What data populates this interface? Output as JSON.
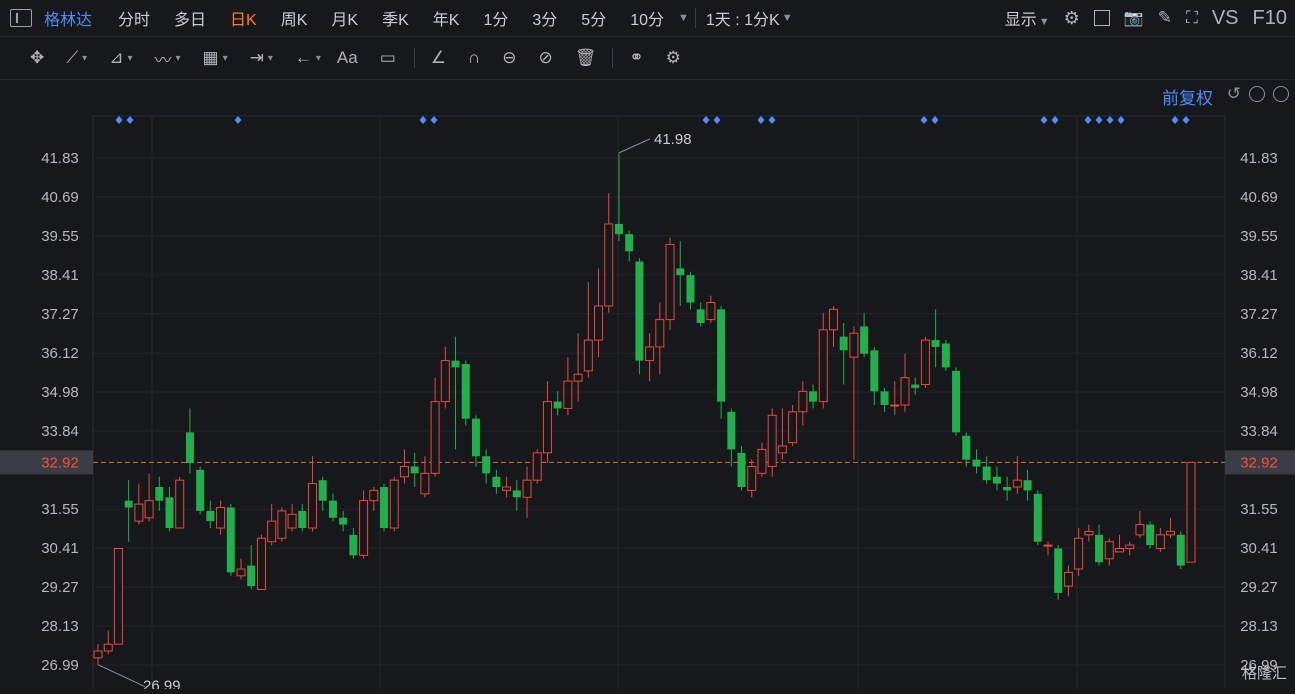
{
  "header": {
    "stock_name": "格林达",
    "tabs": [
      "分时",
      "多日",
      "日K",
      "周K",
      "月K",
      "季K",
      "年K",
      "1分",
      "3分",
      "5分",
      "10分"
    ],
    "active_tab": "日K",
    "period_dropdown": "1天 : 1分K",
    "display_label": "显示",
    "vs_label": "VS",
    "f10_label": "F10"
  },
  "drawing_toolbar": {
    "icons": [
      "move-icon",
      "line-icon",
      "polyline-icon",
      "wave-icon",
      "fib-icon",
      "range-icon",
      "arrow-icon",
      "text-icon",
      "comment-icon",
      "ruler-icon",
      "magnet-icon",
      "eye-link-icon",
      "eye-off-icon",
      "trash-icon",
      "link-icon",
      "settings-icon"
    ],
    "text_tool_label": "Aa"
  },
  "chart": {
    "adjust_label": "前复权",
    "current_price": "32.92",
    "high_label": "41.98",
    "low_label": "26.99",
    "price_ticks": [
      "41.83",
      "40.69",
      "39.55",
      "38.41",
      "37.27",
      "36.12",
      "34.98",
      "33.84",
      "32.92",
      "31.55",
      "30.41",
      "29.27",
      "28.13",
      "26.99"
    ],
    "right_bottom_tick": "26.99",
    "watermark": "格隆汇"
  },
  "chart_data": {
    "type": "candlestick",
    "ylim": [
      26.7,
      42.3
    ],
    "current_price": 32.92,
    "high": 41.98,
    "low": 26.99,
    "candles": [
      [
        27.2,
        27.4,
        27.0,
        27.6
      ],
      [
        27.4,
        27.6,
        27.3,
        28.0
      ],
      [
        27.6,
        30.4,
        27.6,
        30.4
      ],
      [
        31.8,
        31.6,
        30.6,
        32.4
      ],
      [
        31.2,
        31.7,
        31.1,
        32.3
      ],
      [
        31.3,
        31.8,
        31.2,
        32.6
      ],
      [
        32.2,
        31.8,
        31.5,
        32.5
      ],
      [
        31.9,
        31.0,
        30.9,
        32.2
      ],
      [
        31.0,
        32.4,
        31.0,
        32.5
      ],
      [
        33.8,
        32.9,
        32.6,
        34.5
      ],
      [
        32.7,
        31.5,
        31.4,
        32.8
      ],
      [
        31.5,
        31.2,
        31.0,
        31.8
      ],
      [
        31.0,
        31.6,
        30.8,
        31.8
      ],
      [
        31.6,
        29.7,
        29.6,
        31.7
      ],
      [
        29.6,
        29.8,
        29.5,
        30.1
      ],
      [
        29.9,
        29.3,
        29.2,
        30.5
      ],
      [
        29.2,
        30.7,
        29.2,
        30.8
      ],
      [
        30.6,
        31.2,
        30.5,
        31.7
      ],
      [
        30.7,
        31.5,
        30.6,
        31.6
      ],
      [
        31.0,
        31.4,
        30.9,
        31.7
      ],
      [
        31.5,
        31.0,
        30.9,
        31.7
      ],
      [
        31.0,
        32.3,
        30.9,
        33.1
      ],
      [
        32.4,
        31.8,
        31.5,
        32.5
      ],
      [
        31.8,
        31.3,
        31.2,
        32.0
      ],
      [
        31.3,
        31.1,
        30.9,
        31.5
      ],
      [
        30.8,
        30.2,
        30.1,
        31.0
      ],
      [
        30.2,
        31.8,
        30.1,
        32.1
      ],
      [
        31.8,
        32.1,
        31.5,
        32.2
      ],
      [
        32.2,
        31.0,
        30.9,
        32.3
      ],
      [
        31.0,
        32.4,
        30.9,
        32.5
      ],
      [
        32.5,
        32.8,
        32.3,
        33.3
      ],
      [
        32.8,
        32.6,
        32.2,
        33.2
      ],
      [
        32.0,
        32.6,
        31.9,
        33.1
      ],
      [
        32.6,
        34.7,
        32.5,
        35.4
      ],
      [
        34.7,
        35.9,
        34.5,
        36.3
      ],
      [
        35.9,
        35.7,
        33.3,
        36.6
      ],
      [
        35.8,
        34.2,
        34.0,
        35.9
      ],
      [
        34.2,
        33.1,
        32.8,
        34.3
      ],
      [
        33.1,
        32.6,
        32.3,
        33.3
      ],
      [
        32.5,
        32.2,
        32.0,
        32.7
      ],
      [
        32.1,
        32.2,
        31.9,
        32.5
      ],
      [
        32.1,
        31.9,
        31.5,
        32.4
      ],
      [
        31.9,
        32.4,
        31.3,
        32.8
      ],
      [
        32.4,
        33.2,
        32.3,
        33.3
      ],
      [
        33.2,
        34.7,
        32.9,
        35.3
      ],
      [
        34.7,
        34.5,
        34.3,
        35.0
      ],
      [
        34.5,
        35.3,
        34.3,
        36.0
      ],
      [
        35.3,
        35.5,
        34.7,
        36.7
      ],
      [
        35.6,
        36.5,
        35.4,
        38.2
      ],
      [
        36.5,
        37.5,
        36.0,
        38.6
      ],
      [
        37.5,
        39.9,
        37.3,
        40.8
      ],
      [
        39.9,
        39.6,
        39.4,
        41.98
      ],
      [
        39.6,
        39.1,
        38.8,
        39.7
      ],
      [
        38.8,
        35.9,
        35.5,
        38.9
      ],
      [
        35.9,
        36.3,
        35.3,
        36.7
      ],
      [
        36.3,
        37.1,
        35.5,
        37.6
      ],
      [
        37.1,
        39.3,
        36.8,
        39.5
      ],
      [
        38.6,
        38.4,
        37.5,
        39.4
      ],
      [
        38.4,
        37.6,
        37.4,
        38.5
      ],
      [
        37.4,
        37.0,
        36.9,
        37.6
      ],
      [
        37.1,
        37.6,
        37.0,
        37.8
      ],
      [
        37.4,
        34.7,
        34.2,
        37.5
      ],
      [
        34.4,
        33.3,
        32.8,
        34.5
      ],
      [
        33.2,
        32.2,
        32.1,
        33.4
      ],
      [
        32.1,
        32.8,
        31.9,
        33.0
      ],
      [
        32.6,
        33.3,
        32.5,
        33.5
      ],
      [
        32.8,
        34.3,
        32.5,
        34.5
      ],
      [
        33.2,
        33.4,
        33.0,
        34.5
      ],
      [
        33.5,
        34.4,
        33.4,
        34.6
      ],
      [
        34.4,
        35.0,
        34.0,
        35.3
      ],
      [
        35.0,
        34.7,
        34.5,
        35.2
      ],
      [
        34.7,
        36.8,
        34.5,
        37.3
      ],
      [
        36.8,
        37.4,
        36.3,
        37.5
      ],
      [
        36.6,
        36.2,
        35.2,
        37.0
      ],
      [
        36.0,
        36.7,
        33.0,
        36.9
      ],
      [
        36.9,
        36.1,
        36.0,
        37.3
      ],
      [
        36.2,
        35.0,
        34.6,
        36.3
      ],
      [
        35.0,
        34.6,
        34.4,
        35.1
      ],
      [
        34.6,
        34.6,
        34.3,
        35.3
      ],
      [
        34.6,
        35.4,
        34.4,
        36.1
      ],
      [
        35.2,
        35.1,
        34.9,
        35.4
      ],
      [
        35.2,
        36.5,
        35.1,
        36.6
      ],
      [
        36.5,
        36.3,
        35.7,
        37.4
      ],
      [
        36.4,
        35.7,
        35.6,
        36.5
      ],
      [
        35.6,
        33.8,
        33.7,
        35.7
      ],
      [
        33.7,
        33.0,
        32.8,
        33.8
      ],
      [
        33.0,
        32.8,
        32.6,
        33.3
      ],
      [
        32.8,
        32.4,
        32.3,
        33.1
      ],
      [
        32.5,
        32.3,
        32.1,
        32.8
      ],
      [
        32.2,
        32.1,
        31.8,
        32.5
      ],
      [
        32.2,
        32.4,
        32.0,
        33.1
      ],
      [
        32.4,
        32.1,
        31.8,
        32.7
      ],
      [
        32.0,
        30.6,
        30.5,
        32.1
      ],
      [
        30.5,
        30.5,
        30.2,
        30.6
      ],
      [
        30.4,
        29.1,
        28.9,
        30.5
      ],
      [
        29.3,
        29.7,
        29.0,
        29.9
      ],
      [
        29.8,
        30.7,
        29.6,
        31.0
      ],
      [
        30.8,
        30.9,
        30.6,
        31.1
      ],
      [
        30.8,
        30.0,
        29.9,
        31.1
      ],
      [
        30.1,
        30.6,
        29.9,
        30.7
      ],
      [
        30.3,
        30.4,
        30.3,
        30.8
      ],
      [
        30.4,
        30.5,
        30.2,
        30.6
      ],
      [
        30.8,
        31.1,
        30.7,
        31.5
      ],
      [
        31.1,
        30.5,
        30.4,
        31.2
      ],
      [
        30.4,
        30.8,
        30.3,
        31.0
      ],
      [
        30.8,
        30.9,
        30.7,
        31.3
      ],
      [
        30.8,
        29.9,
        29.8,
        30.9
      ],
      [
        30.0,
        32.92,
        30.0,
        32.92
      ]
    ],
    "marker_groups": 10
  }
}
